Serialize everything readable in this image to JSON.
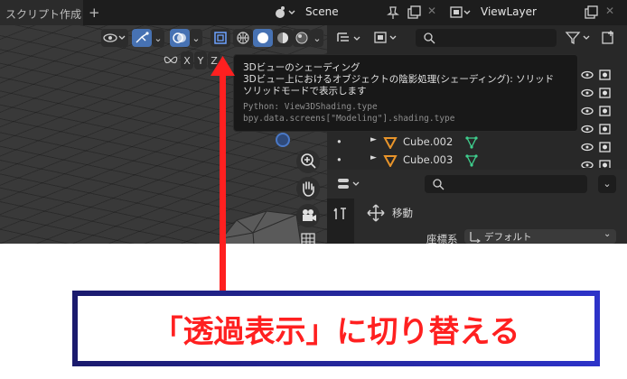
{
  "topbar": {
    "workspace_tab": "スクリプト作成",
    "add_tab": "+",
    "scene_name": "Scene",
    "viewlayer_name": "ViewLayer"
  },
  "viewport": {
    "axis_x": "X",
    "axis_y": "Y",
    "axis_z": "Z"
  },
  "tooltip": {
    "title": "3Dビューのシェーディング",
    "description": "3Dビュー上におけるオブジェクトの陰影処理(シェーディング): ソリッド",
    "detail": "ソリッドモードで表示します",
    "python1": "Python: View3DShading.type",
    "python2": "bpy.data.screens[\"Modeling\"].shading.type"
  },
  "outliner": {
    "items": [
      {
        "name": "Cube.002"
      },
      {
        "name": "Cube.003"
      }
    ]
  },
  "properties": {
    "tool_name": "移動",
    "coord_label": "座標系",
    "coord_value": "デフォルト"
  },
  "annotation": {
    "caption": "「透過表示」に切り替える",
    "color": "#ff2020"
  }
}
